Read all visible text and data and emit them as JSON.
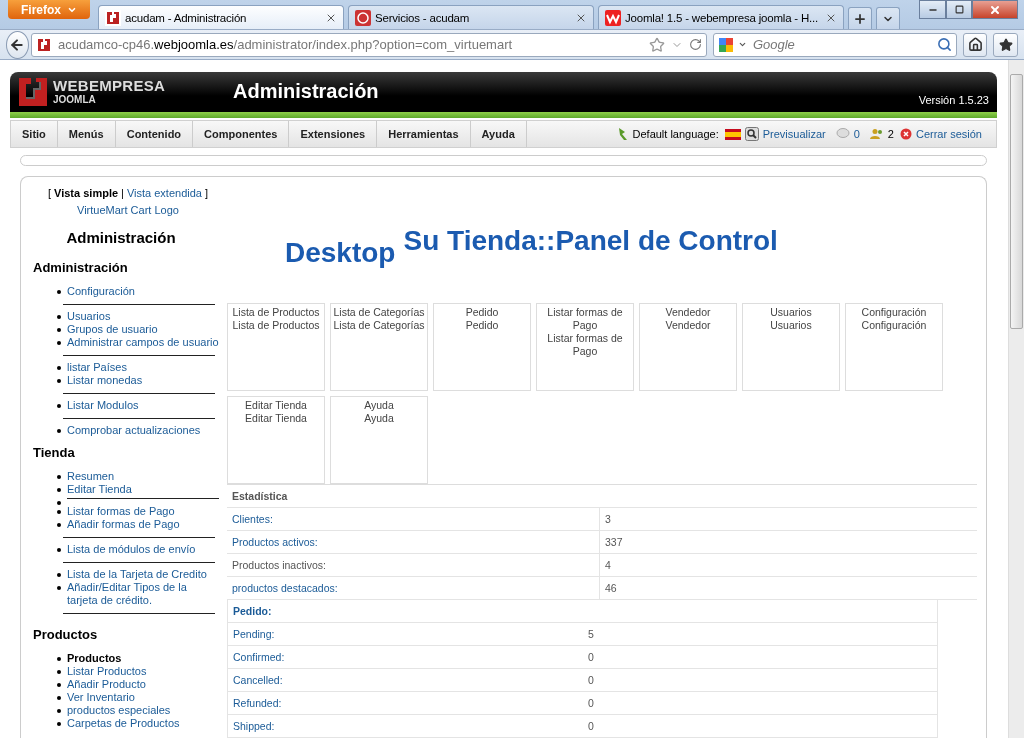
{
  "browser": {
    "menu_button": "Firefox",
    "tabs": [
      {
        "kind": "joomla",
        "title": "acudam - Administración",
        "selected": true
      },
      {
        "kind": "service",
        "title": "Servicios - acudam",
        "selected": false
      },
      {
        "kind": "webempresa",
        "title": "Joomla! 1.5 - webempresa joomla - H...",
        "selected": false
      }
    ],
    "address": "acudamco-cp46.**webjoomla.es**/administrator/index.php?option=com_virtuemart",
    "search": {
      "placeholder": "Google"
    }
  },
  "header": {
    "brand": "WEBEMPRESA",
    "brand_sub": "JOOMLA",
    "title": "Administración",
    "version": "Versión 1.5.23"
  },
  "menu": [
    "Sitio",
    "Menús",
    "Contenido",
    "Componentes",
    "Extensiones",
    "Herramientas",
    "Ayuda"
  ],
  "status": {
    "language_label": "Default language:",
    "preview": "Previsualizar",
    "messages": "0",
    "users": "2",
    "logout": "Cerrar sesión"
  },
  "view_switch": {
    "open": "[",
    "options": [
      {
        "label": "Vista simple",
        "selected": true
      },
      {
        "label": "Vista extendida",
        "selected": false
      }
    ],
    "separator": "|",
    "close": "]"
  },
  "cart_logo": "VirtueMart Cart Logo",
  "sidebar": {
    "title": "Administración",
    "sections": [
      {
        "heading": "Administración",
        "items": [
          {
            "kind": "link",
            "label": "Configuración"
          },
          {
            "kind": "rule"
          },
          {
            "kind": "link",
            "label": "Usuarios"
          },
          {
            "kind": "link",
            "label": "Grupos de usuario"
          },
          {
            "kind": "link",
            "label": "Administrar campos de usuario"
          },
          {
            "kind": "rule"
          },
          {
            "kind": "link",
            "label": "listar Países"
          },
          {
            "kind": "link",
            "label": "Listar monedas"
          },
          {
            "kind": "rule"
          },
          {
            "kind": "link",
            "label": "Listar Modulos"
          },
          {
            "kind": "rule"
          },
          {
            "kind": "link",
            "label": "Comprobar actualizaciones"
          }
        ]
      },
      {
        "heading": "Tienda",
        "items": [
          {
            "kind": "link",
            "label": "Resumen"
          },
          {
            "kind": "link",
            "label": "Editar Tienda"
          },
          {
            "kind": "blank"
          },
          {
            "kind": "link",
            "label": "Listar formas de Pago"
          },
          {
            "kind": "link",
            "label": "Añadir formas de Pago"
          },
          {
            "kind": "rule"
          },
          {
            "kind": "link",
            "label": "Lista de módulos de envío"
          },
          {
            "kind": "rule"
          },
          {
            "kind": "link",
            "label": "Lista de la Tarjeta de Credito"
          },
          {
            "kind": "link",
            "label": "Añadir/Editar Tipos de la tarjeta de crédito."
          },
          {
            "kind": "rule"
          }
        ]
      },
      {
        "heading": "Productos",
        "items": [
          {
            "kind": "current",
            "label": "Productos"
          },
          {
            "kind": "link",
            "label": "Listar Productos"
          },
          {
            "kind": "link",
            "label": "Añadir Producto"
          },
          {
            "kind": "link",
            "label": "Ver Inventario"
          },
          {
            "kind": "link",
            "label": "productos especiales"
          },
          {
            "kind": "link",
            "label": "Carpetas de Productos"
          }
        ]
      }
    ]
  },
  "page_title": {
    "prefix": "Desktop",
    "title": "Su Tienda::Panel de Control"
  },
  "panels": [
    {
      "lines": [
        "Lista de Productos",
        "Lista de Productos"
      ]
    },
    {
      "lines": [
        "Lista de Categorías",
        "Lista de Categorías"
      ]
    },
    {
      "lines": [
        "Pedido",
        "Pedido"
      ]
    },
    {
      "lines": [
        "Listar formas de Pago",
        "Listar formas de Pago"
      ]
    },
    {
      "lines": [
        "Vendedor",
        "Vendedor"
      ]
    },
    {
      "lines": [
        "Usuarios",
        "Usuarios"
      ]
    },
    {
      "lines": [
        "Configuración",
        "Configuración"
      ]
    },
    {
      "lines": [
        "Editar Tienda",
        "Editar Tienda"
      ]
    },
    {
      "lines": [
        "Ayuda",
        "Ayuda"
      ]
    }
  ],
  "statistics": {
    "heading": "Estadística",
    "rows": [
      {
        "label": "Clientes:",
        "value": "3",
        "link": true
      },
      {
        "label": "Productos activos:",
        "value": "337",
        "link": true
      },
      {
        "label": "Productos inactivos:",
        "value": "4",
        "link": false
      },
      {
        "label": "productos destacados:",
        "value": "46",
        "link": true
      }
    ]
  },
  "orders": {
    "heading": "Pedido:",
    "rows": [
      {
        "label": "Pending:",
        "value": "5"
      },
      {
        "label": "Confirmed:",
        "value": "0"
      },
      {
        "label": "Cancelled:",
        "value": "0"
      },
      {
        "label": "Refunded:",
        "value": "0"
      },
      {
        "label": "Shipped:",
        "value": "0"
      }
    ]
  }
}
